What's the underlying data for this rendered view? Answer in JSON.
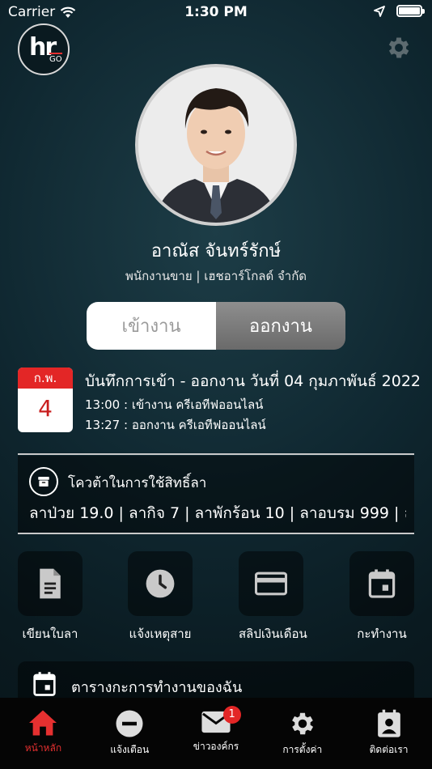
{
  "status_bar": {
    "carrier": "Carrier",
    "time": "1:30 PM"
  },
  "header": {
    "logo_text": "hr",
    "logo_sub": "GO"
  },
  "profile": {
    "name": "อาณัส จันทร์รักษ์",
    "subtitle": "พนักงานขาย | เฮชอาร์โกลด์ จำกัด"
  },
  "toggle": {
    "check_in_label": "เข้างาน",
    "check_out_label": "ออกงาน",
    "selected": "ออกงาน"
  },
  "attendance": {
    "calendar_month": "ก.พ.",
    "calendar_day": "4",
    "title": "บันทึกการเข้า - ออกงาน วันที่ 04 กุมภาพันธ์ 2022",
    "records": [
      {
        "text": "13:00 : เข้างาน  ครีเอทีฟออนไลน์"
      },
      {
        "text": "13:27 : ออกงาน  ครีเอทีฟออนไลน์"
      }
    ]
  },
  "leave_quota": {
    "title": "โควต้าในการใช้สิทธิ์ลา",
    "values_text": "ลาป่วย 19.0 | ลากิจ 7 | ลาพักร้อน 10 | ลาอบรม 999 | ล"
  },
  "quick_actions": [
    {
      "label": "เขียนใบลา",
      "icon": "document-icon"
    },
    {
      "label": "แจ้งเหตุสาย",
      "icon": "clock-icon"
    },
    {
      "label": "สลิปเงินเดือน",
      "icon": "credit-card-icon"
    },
    {
      "label": "กะทำงาน",
      "icon": "calendar-icon"
    }
  ],
  "schedule": {
    "title": "ตารางกะการทำงานของฉัน"
  },
  "tabbar": {
    "items": [
      {
        "label": "หน้าหลัก",
        "icon": "home-icon",
        "active": true
      },
      {
        "label": "แจ้งเตือน",
        "icon": "minus-circle-icon",
        "active": false
      },
      {
        "label": "ข่าวองค์กร",
        "icon": "mail-icon",
        "active": false,
        "badge": "1"
      },
      {
        "label": "การตั้งค่า",
        "icon": "gear-icon",
        "active": false
      },
      {
        "label": "ติดต่อเรา",
        "icon": "contact-icon",
        "active": false
      }
    ]
  },
  "colors": {
    "accent": "#e53030",
    "background": "#0f2730"
  }
}
